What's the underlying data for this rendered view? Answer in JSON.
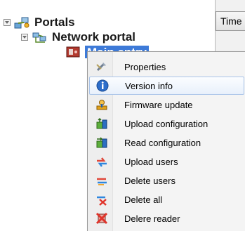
{
  "header": {
    "time_column": "Time"
  },
  "tree": {
    "root": {
      "label": "Portals"
    },
    "child": {
      "label": "Network portal"
    },
    "selected": {
      "label": "Main entry"
    }
  },
  "context_menu": {
    "items": [
      {
        "label": "Properties",
        "icon": "properties-icon"
      },
      {
        "label": "Version info",
        "icon": "info-icon"
      },
      {
        "label": "Firmware update",
        "icon": "firmware-update-icon"
      },
      {
        "label": "Upload configuration",
        "icon": "upload-configuration-icon"
      },
      {
        "label": "Read configuration",
        "icon": "read-configuration-icon"
      },
      {
        "label": "Upload users",
        "icon": "upload-users-icon"
      },
      {
        "label": "Delete users",
        "icon": "delete-users-icon"
      },
      {
        "label": "Delete all",
        "icon": "delete-all-icon"
      },
      {
        "label": "Delere reader",
        "icon": "delete-reader-icon"
      }
    ],
    "highlighted": "Version info"
  }
}
